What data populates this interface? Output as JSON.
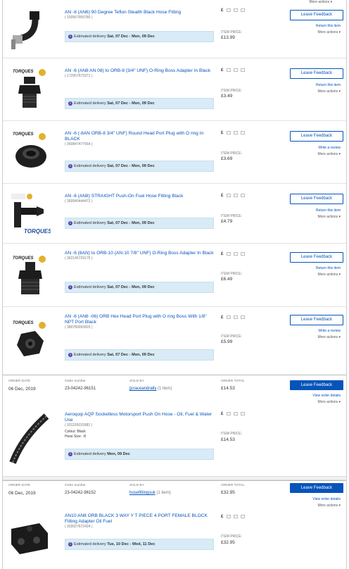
{
  "top_more": "More actions",
  "items": [
    {
      "title": "AN -6 (AN6) 90 Degree Teflon Stealth Black Hose Fitting",
      "item_no": "( 150567959780 )",
      "delivery_prefix": "Estimated delivery",
      "delivery_dates": "Sat, 07 Dec - Mon, 09 Dec",
      "currency": "£",
      "price_label": "ITEM PRICE:",
      "price": "£13.99",
      "button": "Leave Feedback",
      "link": "Return this item",
      "more": "More actions"
    },
    {
      "title": "AN -6 (AN8 AN 08) to ORB-8 (3/4\" UNF) O-Ring Boss Adapter In Black",
      "item_no": "( 172957673371 )",
      "delivery_prefix": "Estimated delivery",
      "delivery_dates": "Sat, 07 Dec - Mon, 09 Dec",
      "currency": "£",
      "price_label": "ITEM PRICE:",
      "price": "£3.49",
      "button": "Leave Feedback",
      "link": "Return this item",
      "more": "More actions"
    },
    {
      "title": "AN -6 (-8AN ORB-8 3/4\" UNF) Round Head Port Plug with O ring In BLACK",
      "item_no": "( 360847477564 )",
      "delivery_prefix": "Estimated delivery",
      "delivery_dates": "Sat, 07 Dec - Mon, 09 Dec",
      "currency": "£",
      "price_label": "ITEM PRICE:",
      "price": "£3.69",
      "button": "Leave Feedback",
      "link": "Write a review",
      "more": "More actions"
    },
    {
      "title": "AN -6 (AN8) STRAIGHT Push-On Fuel Hose Fitting Black",
      "item_no": "( 360940444472 )",
      "delivery_prefix": "Estimated delivery",
      "delivery_dates": "Sat, 07 Dec - Mon, 09 Dec",
      "currency": "£",
      "price_label": "ITEM PRICE:",
      "price": "£4.79",
      "button": "Leave Feedback",
      "link": "Return this item",
      "more": "More actions"
    },
    {
      "title": "AN -6 (8AN) to ORB-10 (AN-10 7/8\" UNF) O-Ring Boss Adapter In Black",
      "item_no": "( 362145729175 )",
      "delivery_prefix": "Estimated delivery",
      "delivery_dates": "Sat, 07 Dec - Mon, 09 Dec",
      "currency": "£",
      "price_label": "ITEM PRICE:",
      "price": "£6.49",
      "button": "Leave Feedback",
      "link": "Return this item",
      "more": "More actions"
    },
    {
      "title": "AN -6 (AN6 -06) ORB Hex Head Port Plug with O ring Boss With 1/8\" NPT Port Black",
      "item_no": "( 380780093820 )",
      "delivery_prefix": "Estimated delivery",
      "delivery_dates": "Sat, 07 Dec - Mon, 09 Dec",
      "currency": "£",
      "price_label": "ITEM PRICE:",
      "price": "£5.99",
      "button": "Leave Feedback",
      "link": "Write a review",
      "more": "More actions"
    }
  ],
  "orders": [
    {
      "date_label": "ORDER DATE",
      "date": "06 Dec, 2019",
      "number_label": "Order number",
      "number": "23-04242-96151",
      "sold_label": "SOLD BY",
      "seller": "jjcraceandrally",
      "seller_count": "(1 item)",
      "total_label": "ORDER TOTAL",
      "total": "£14.53",
      "button": "Leave Feedback",
      "link": "View order details",
      "more": "More actions",
      "item": {
        "title": "Aeroquip AQP Socketless Motorsport Push On Hose - Oil, Fuel & Water Use",
        "item_no": "( 301155015983 )",
        "colour": "Colour: Black",
        "hose_size": "Hose Size: -8",
        "delivery_prefix": "Estimated delivery",
        "delivery_dates": "Mon, 09 Dec",
        "currency": "£",
        "price_label": "ITEM PRICE:",
        "price": "£14.53"
      }
    },
    {
      "date_label": "ORDER DATE",
      "date": "06 Dec, 2019",
      "number_label": "Order number",
      "number": "23-04242-96152",
      "sold_label": "SOLD BY",
      "seller": "hosefittingsuk",
      "seller_count": "(1 item)",
      "total_label": "ORDER TOTAL",
      "total": "£32.95",
      "button": "Leave Feedback",
      "link": "View order details",
      "more": "More actions",
      "item": {
        "title": "AN10 AN8 ORB BLACK 3 WAY Y T PIECE 4 PORT FEMALE BLOCK Fitting Adapter Oil Fuel",
        "item_no": "( 302027672424 )",
        "delivery_prefix": "Estimated delivery",
        "delivery_dates": "Tue, 10 Dec - Wed, 11 Dec",
        "currency": "£",
        "price_label": "ITEM PRICE:",
        "price": "£32.95"
      }
    }
  ],
  "thumb_brand": "TORQUES"
}
